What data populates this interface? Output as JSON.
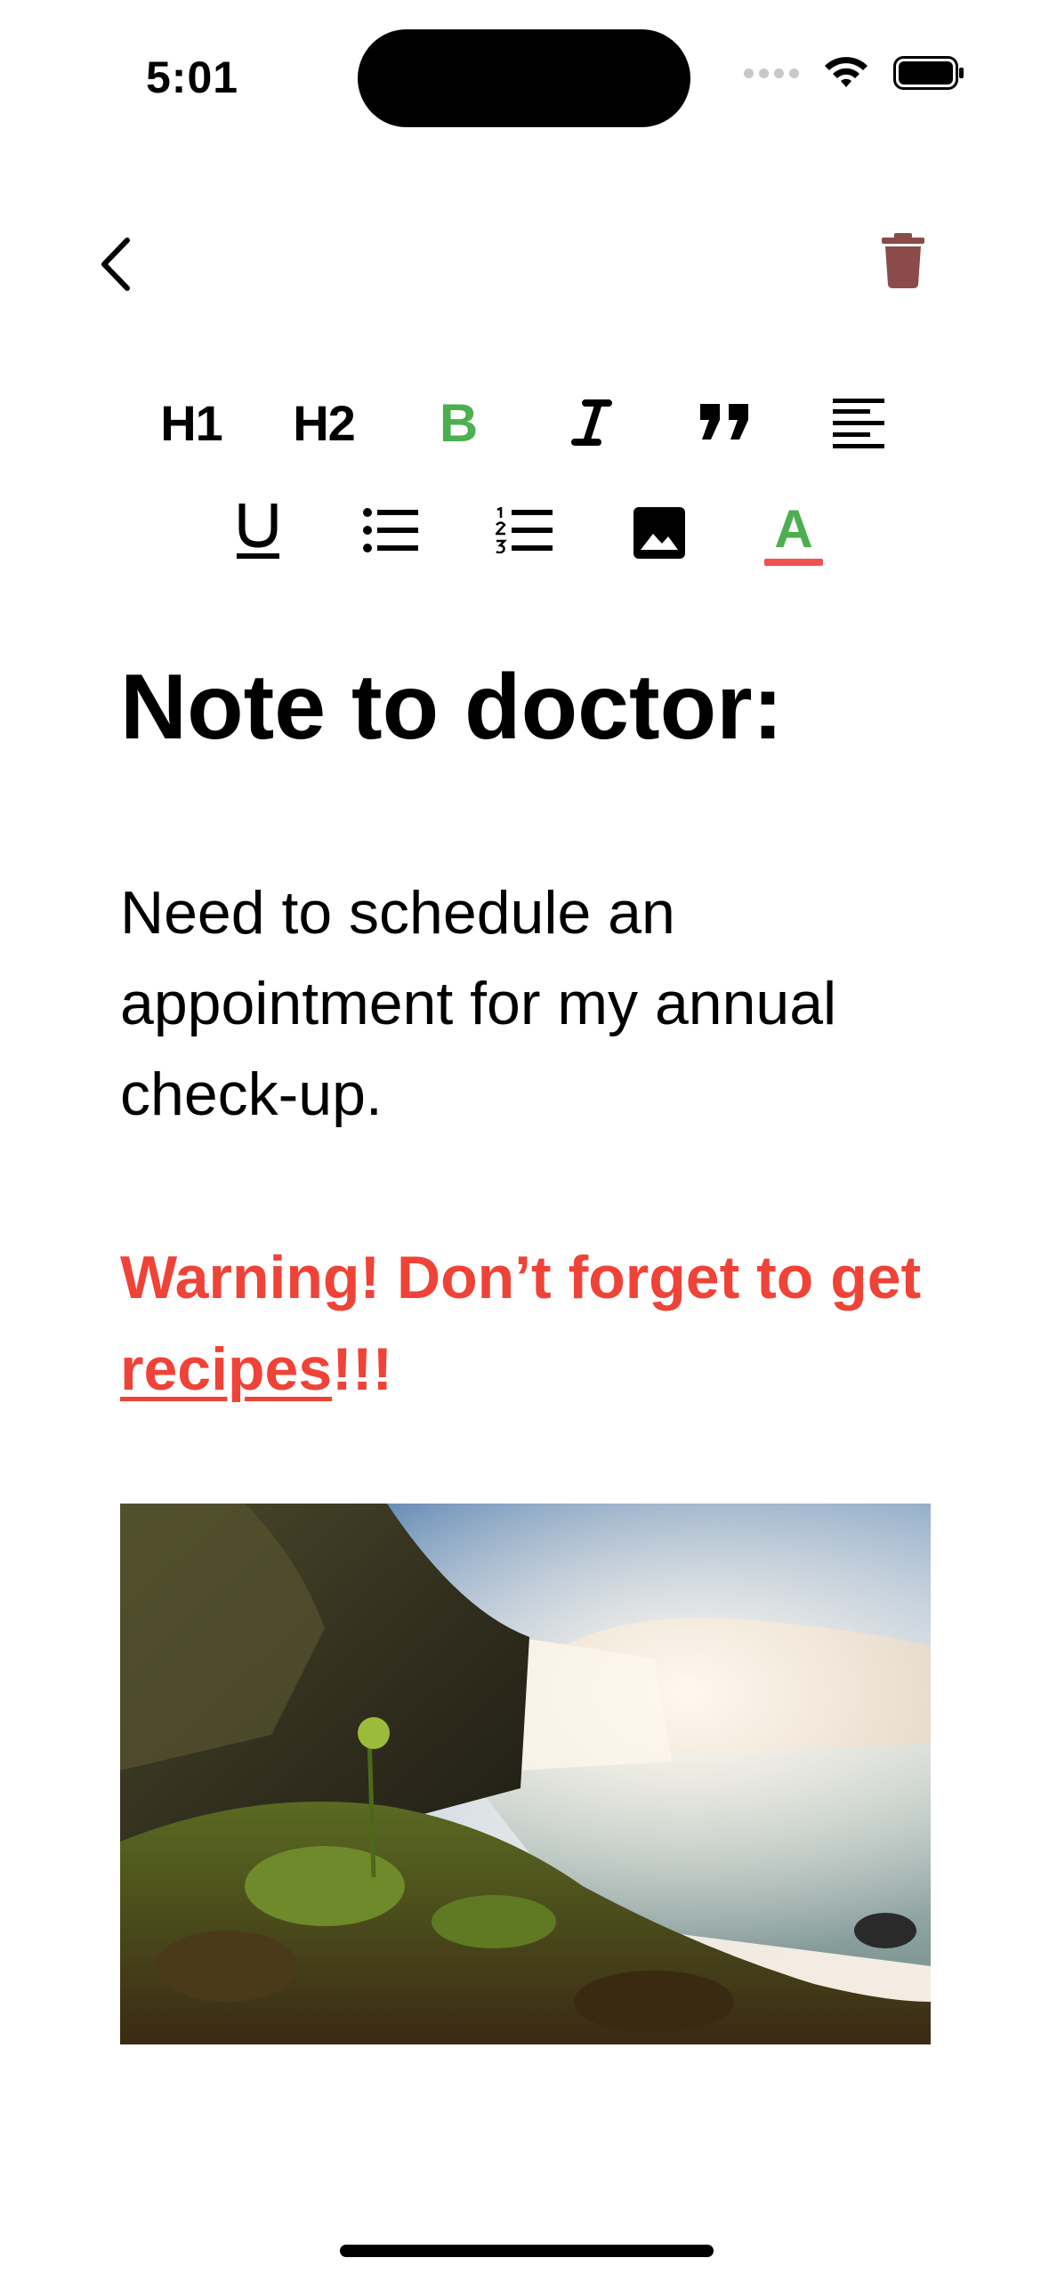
{
  "status_bar": {
    "time": "5:01"
  },
  "nav": {
    "back_icon": "chevron-left-icon",
    "delete_icon": "trash-icon",
    "delete_color": "#8b4b4b"
  },
  "toolbar": {
    "h1": "H1",
    "h2": "H2",
    "bold": "B",
    "italic_icon": "italic-icon",
    "quote_icon": "quote-icon",
    "align_icon": "align-left-icon",
    "underline": "U",
    "bullet_list_icon": "bullet-list-icon",
    "numbered_list_icon": "numbered-list-icon",
    "image_icon": "image-icon",
    "text_color": "A",
    "active_color": "#4caf50",
    "color_bar": "#ef5350"
  },
  "note": {
    "title": "Note to doctor:",
    "body": "Need to schedule an appointment for my annual check-up.",
    "warning_prefix": "Warning! Don’t forget to get ",
    "warning_link": "recipes",
    "warning_suffix": "!!!",
    "warning_color": "#ef4338",
    "image_subject": "waterfall landscape photo"
  }
}
